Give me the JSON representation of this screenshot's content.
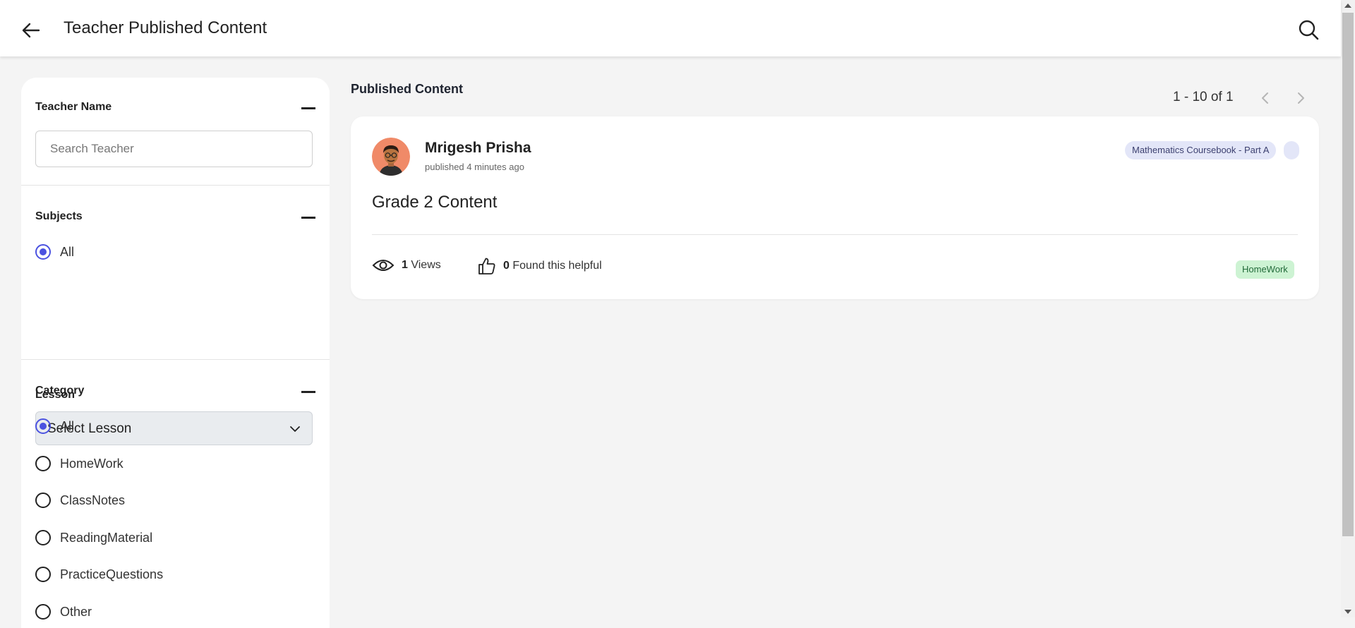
{
  "header": {
    "title": "Teacher Published Content",
    "back_icon": "arrow-left-icon",
    "search_icon": "search-icon"
  },
  "sidebar": {
    "teacher": {
      "title": "Teacher Name",
      "search_placeholder": "Search Teacher",
      "search_value": ""
    },
    "subjects": {
      "title": "Subjects",
      "options": [
        {
          "label": "All",
          "checked": true
        }
      ],
      "lesson_label": "Lesson",
      "lesson_value": "Select Lesson"
    },
    "category": {
      "title": "Category",
      "options": [
        {
          "label": "All",
          "checked": true
        },
        {
          "label": "HomeWork",
          "checked": false
        },
        {
          "label": "ClassNotes",
          "checked": false
        },
        {
          "label": "ReadingMaterial",
          "checked": false
        },
        {
          "label": "PracticeQuestions",
          "checked": false
        },
        {
          "label": "Other",
          "checked": false
        }
      ]
    }
  },
  "main": {
    "heading": "Published Content",
    "pagination": "1 - 10 of 1",
    "posts": [
      {
        "author": "Mrigesh Prisha",
        "published": "published 4 minutes ago",
        "book_tag": "Mathematics Coursebook - Part A",
        "title": "Grade 2 Content",
        "views_count": "1",
        "views_label": "Views",
        "helpful_count": "0",
        "helpful_label": "Found this helpful",
        "category": "HomeWork"
      }
    ]
  },
  "colors": {
    "accent": "#4b52e0",
    "tag_bg": "#e3e6f8",
    "badge_bg": "#cdf3d3",
    "avatar_bg": "#f08a68"
  }
}
